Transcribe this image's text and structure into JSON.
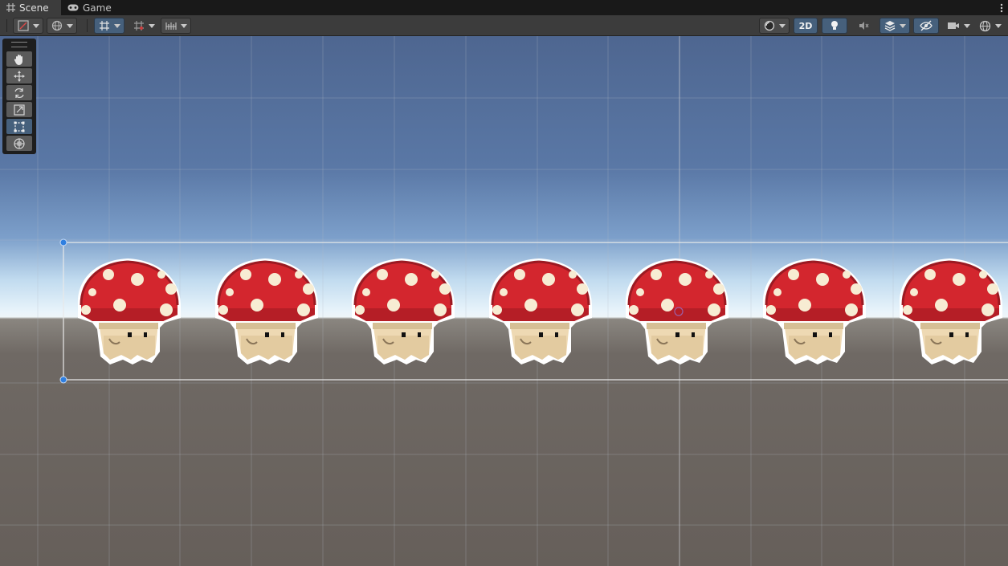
{
  "tabs": [
    {
      "label": "Scene",
      "icon": "grid-icon",
      "active": true
    },
    {
      "label": "Game",
      "icon": "gamepad-icon",
      "active": false
    }
  ],
  "toolbar": {
    "mode_2d_label": "2D"
  },
  "tools": [
    {
      "name": "hand-tool",
      "icon": "hand-icon",
      "selected": false
    },
    {
      "name": "move-tool",
      "icon": "move-arrows-icon",
      "selected": false
    },
    {
      "name": "rotate-tool",
      "icon": "rotate-icon",
      "selected": false
    },
    {
      "name": "scale-tool",
      "icon": "scale-icon",
      "selected": false
    },
    {
      "name": "rect-tool",
      "icon": "rect-transform-icon",
      "selected": true
    },
    {
      "name": "transform-tool",
      "icon": "transform-icon",
      "selected": false
    }
  ],
  "scene": {
    "sprites": [
      {
        "name": "mushroom"
      },
      {
        "name": "mushroom"
      },
      {
        "name": "mushroom"
      },
      {
        "name": "mushroom"
      },
      {
        "name": "mushroom"
      },
      {
        "name": "mushroom"
      },
      {
        "name": "mushroom"
      }
    ],
    "colors": {
      "cap": "#d3262e",
      "cap_dark": "#9b1a22",
      "spot": "#f7ecd3",
      "stem": "#eed9b3",
      "stem_shade": "#d6bf95",
      "outline": "#ffffff",
      "selection": "#e8e8e8",
      "handle": "#2f7fe0"
    }
  }
}
